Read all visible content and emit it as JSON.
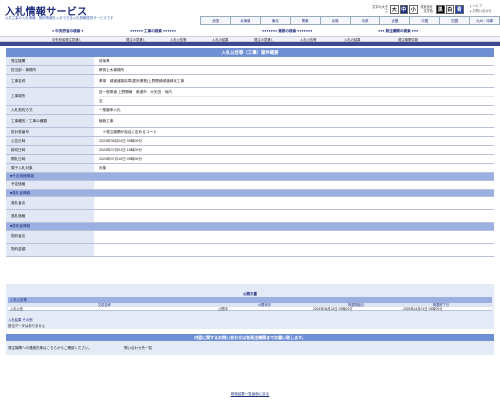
{
  "header": {
    "title": "入札情報サービス",
    "subtitle": "公共工事の入札情報・契約情報を入手できる入札情報提供サービスです",
    "font_size_label": "文字の大きさ",
    "font_sizes": [
      "大",
      "中",
      "小"
    ],
    "color_label": "背景色を文字色",
    "colors": [
      "黒",
      "白",
      "青"
    ],
    "help": "ヘルプ",
    "contact": "お問い合わせ"
  },
  "region_nav": [
    "全国",
    "北海道",
    "東北",
    "関東",
    "北陸",
    "中部",
    "近畿",
    "中国",
    "四国",
    "九州・沖縄"
  ],
  "category_nav": {
    "groups": [
      "中央府省の検索",
      "工事の検索",
      "業務の検索",
      "発注機関の検索"
    ],
    "links": [
      "中央府省発注見通し",
      "発注の見通し",
      "入札公告等",
      "入札の結果",
      "発注の見通し",
      "入札公告等",
      "入札の結果",
      "発注機関情報"
    ]
  },
  "detail": {
    "section_title": "入札公告等（工事）案件概要",
    "fields": [
      {
        "label": "発注機関",
        "value": "岐阜県"
      },
      {
        "label": "担当部・事務所",
        "value": "教育土木事務所"
      },
      {
        "label": "工事名称",
        "value": "県単　緑道道路除草(委託業務)上野間緑緑道緑化工事"
      },
      {
        "label": "工事場所",
        "values": [
          "自一般県道 上野間線　美濃市　大矢田　地内",
          "至"
        ]
      },
      {
        "label": "入札契約方式",
        "value": "一般競争入札"
      },
      {
        "label": "工事種別／工事の種類",
        "value": "植栽工事"
      },
      {
        "label": "設計書番号",
        "value": "　※発注機関が独自に定めるコード"
      },
      {
        "label": "公告日時",
        "value": "2024年06月24日 09時00分"
      },
      {
        "label": "締切日時",
        "value": "2024年07月01日 16時00分"
      },
      {
        "label": "開札日時",
        "value": "2024年07月10日 09時00分"
      },
      {
        "label": "電子入札対象",
        "value": "対象"
      }
    ],
    "groups": [
      {
        "heading": "■予定価格情報",
        "fields": [
          {
            "label": "予定価格",
            "value": ""
          }
        ]
      },
      {
        "heading": "■落札者情報",
        "fields": [
          {
            "label": "落札者名",
            "value": ""
          },
          {
            "label": "落札価格",
            "value": ""
          }
        ]
      },
      {
        "heading": "■契約者情報",
        "fields": [
          {
            "label": "契約者名",
            "value": ""
          },
          {
            "label": "契約金額",
            "value": ""
          }
        ]
      }
    ]
  },
  "notice": {
    "section_title": "公開文書",
    "subheading": "入札公告等",
    "columns": [
      "文書名称",
      "公開状況",
      "掲載開始日",
      "掲載終了日"
    ],
    "rows": [
      {
        "name": "入札公告",
        "status": "公開中",
        "start": "2024年06月24日 09時00分",
        "end": "2028年04月01日 09時00分"
      }
    ],
    "other_title": "入札結果 その他",
    "other_value": "該当データはありません"
  },
  "contact": {
    "bar_title": "内容に関するお問い合わせは各発注機関までお願い致します。",
    "text": "発注機関への連絡先等はこちらからご確認ください。",
    "link": "問い合わせ先一覧"
  },
  "footer": {
    "back_link": "検索結果一覧画面に戻る"
  },
  "colors": {
    "primary": "#1e2d7c",
    "bar": "#6f8fd5",
    "label_bg": "#e1e7f5",
    "sub_bg": "#9bb0e0"
  }
}
